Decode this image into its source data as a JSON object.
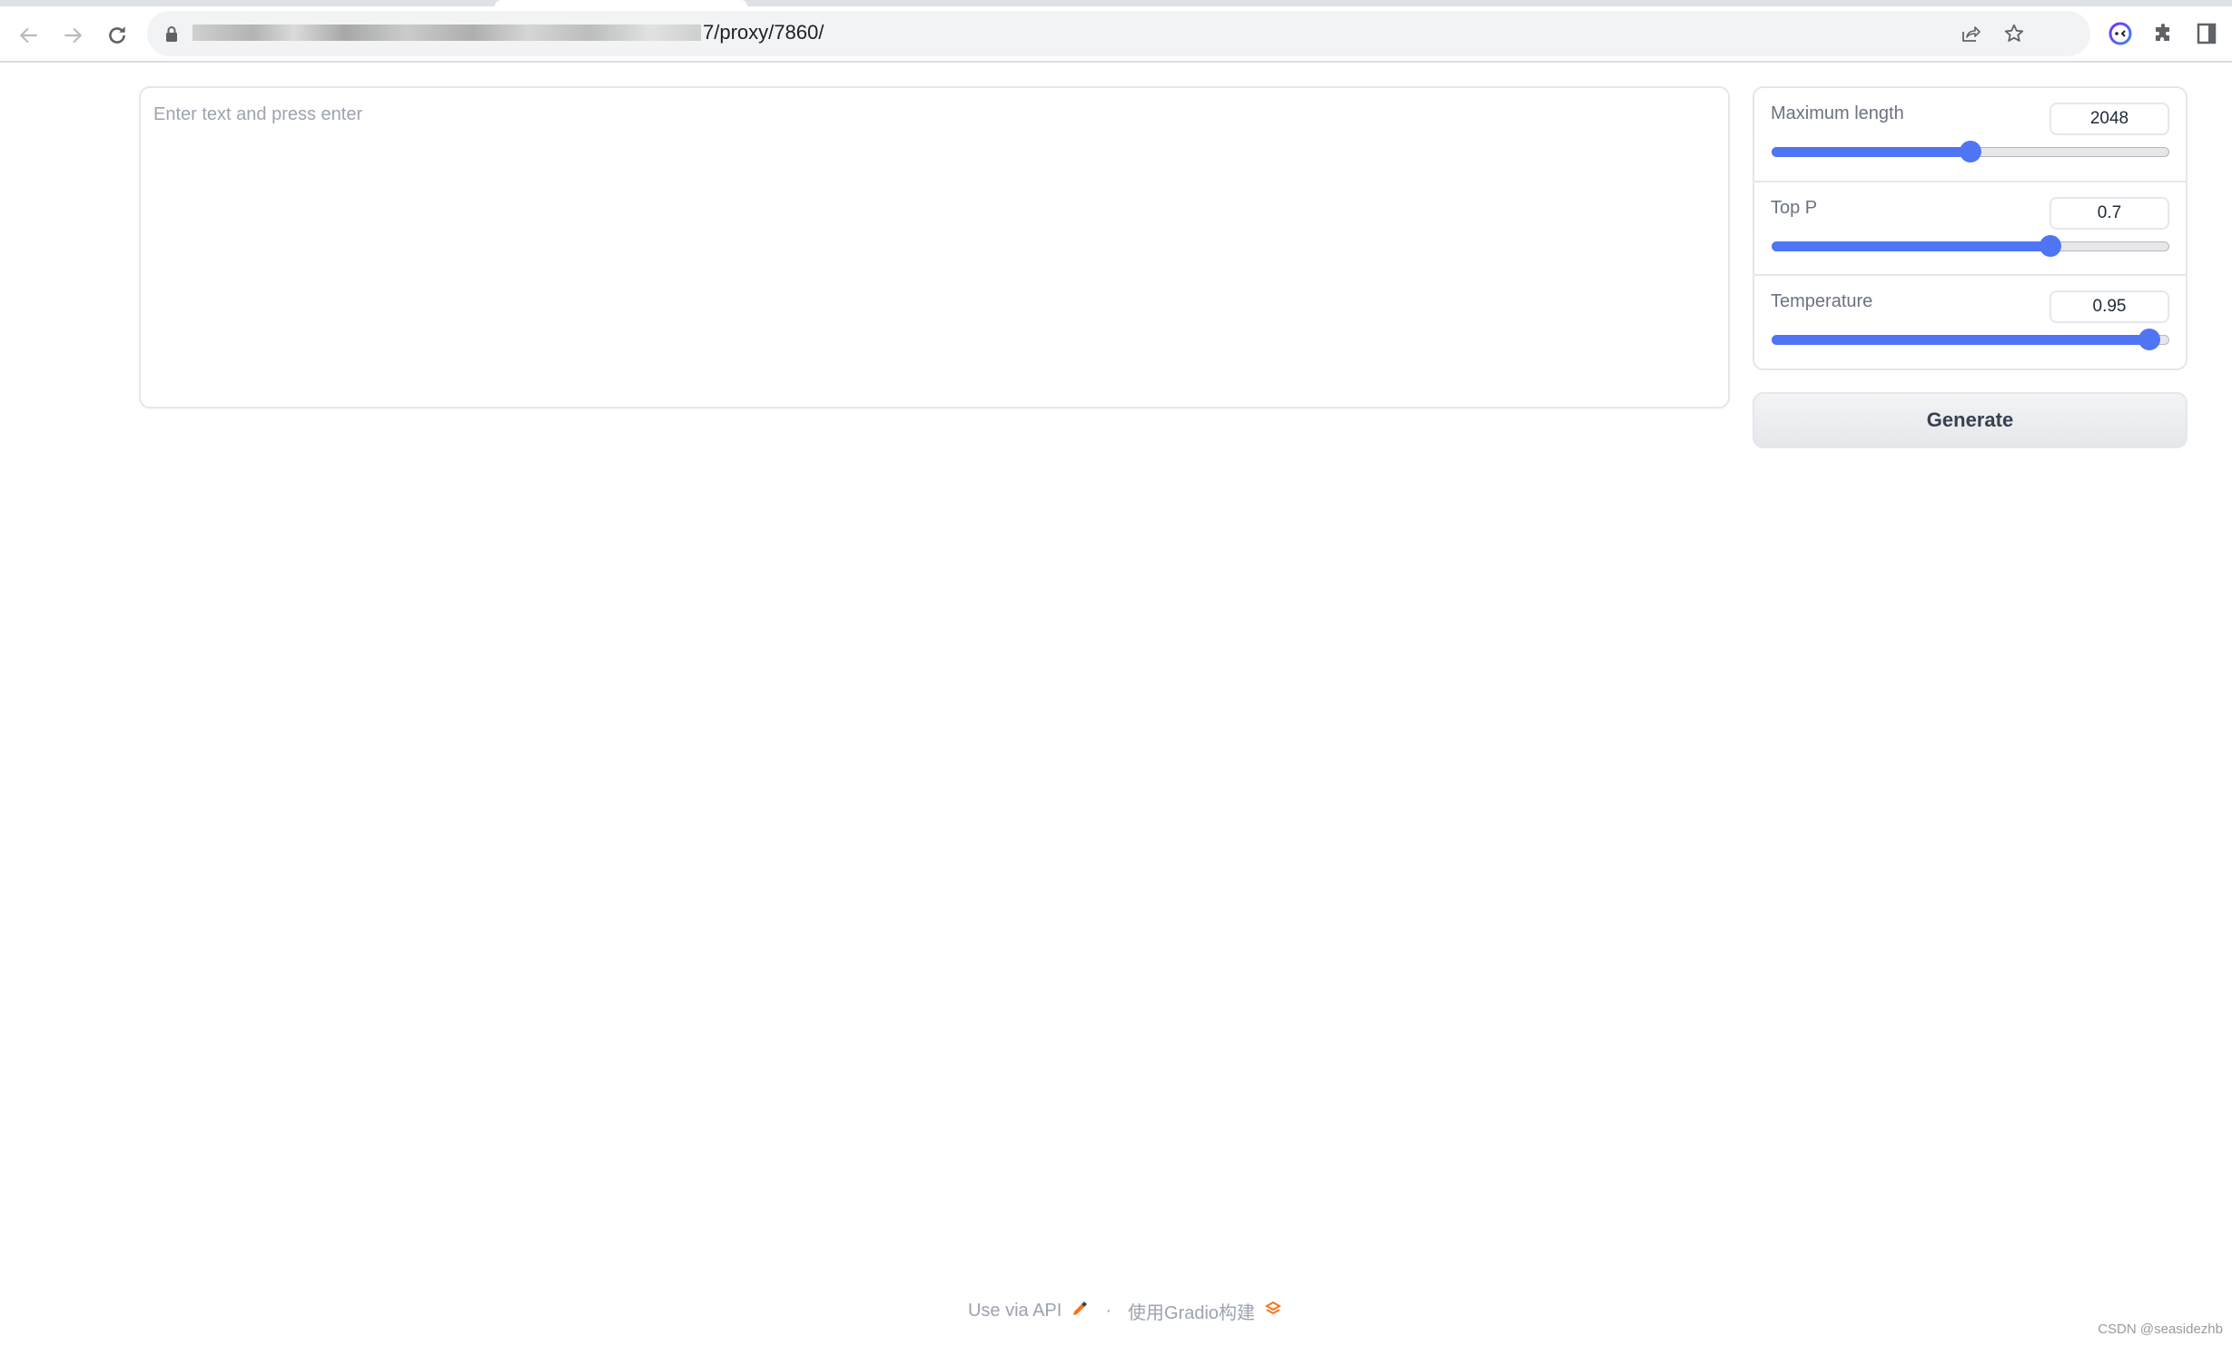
{
  "browser": {
    "url_visible_suffix": "7/proxy/7860/",
    "icons": {
      "back": "arrow-left-icon",
      "forward": "arrow-right-icon",
      "reload": "reload-icon",
      "lock": "lock-icon",
      "share": "share-icon",
      "bookmark": "star-icon",
      "extension": "extension-face-icon",
      "extensions": "puzzle-icon",
      "side_panel": "side-panel-icon"
    }
  },
  "main": {
    "input": {
      "placeholder": "Enter text and press enter",
      "value": ""
    },
    "parameters": [
      {
        "label": "Maximum length",
        "value": "2048",
        "min": 0,
        "max": 4096,
        "fraction": 0.5
      },
      {
        "label": "Top P",
        "value": "0.7",
        "min": 0,
        "max": 1,
        "fraction": 0.7
      },
      {
        "label": "Temperature",
        "value": "0.95",
        "min": 0,
        "max": 1,
        "fraction": 0.95
      }
    ],
    "generate_label": "Generate"
  },
  "footer": {
    "api_link": "Use via API",
    "separator": "·",
    "built_with": "使用Gradio构建"
  },
  "watermark": "CSDN @seasidezhb",
  "colors": {
    "accent": "#4f75f5",
    "orange": "#f97316"
  }
}
